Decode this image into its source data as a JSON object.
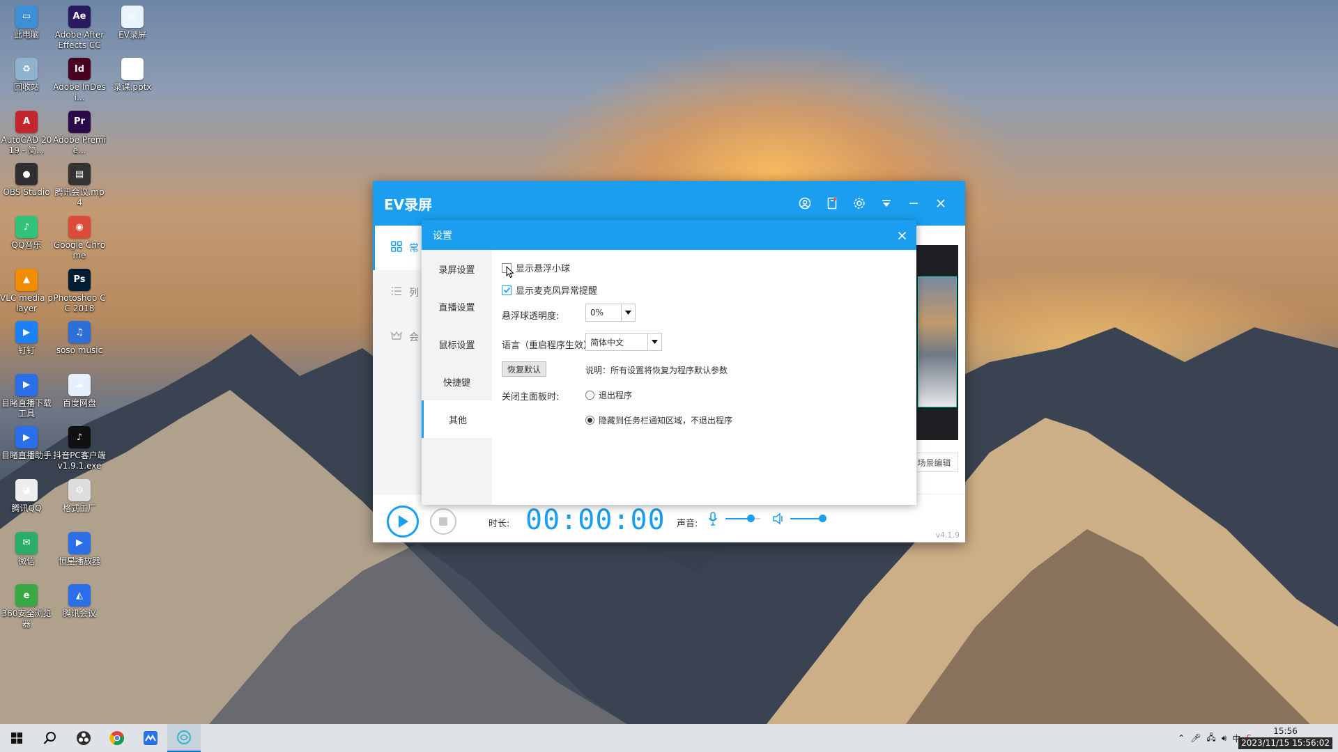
{
  "desktop_icons": [
    {
      "label": "此电脑",
      "color": "#3d8fd6",
      "glyph": "▭"
    },
    {
      "label": "Adobe After Effects CC ...",
      "color": "#2a1a5e",
      "glyph": "Ae"
    },
    {
      "label": "EV录屏",
      "color": "#e9f3fb",
      "glyph": "◎"
    },
    {
      "label": "回收站",
      "color": "#8fb2cf",
      "glyph": "♻"
    },
    {
      "label": "Adobe InDesi...",
      "color": "#49021f",
      "glyph": "Id"
    },
    {
      "label": "录课.pptx",
      "color": "#ffffff",
      "glyph": ""
    },
    {
      "label": "AutoCAD 2019 - 简...",
      "color": "#c4262e",
      "glyph": "A"
    },
    {
      "label": "Adobe Premie...",
      "color": "#2a0a4a",
      "glyph": "Pr"
    },
    {
      "label": "OBS Studio",
      "color": "#302e31",
      "glyph": "●"
    },
    {
      "label": "腾讯会议.mp4",
      "color": "#333333",
      "glyph": "▤"
    },
    {
      "label": "QQ音乐",
      "color": "#31c27c",
      "glyph": "♪"
    },
    {
      "label": "Google Chrome",
      "color": "#dd4b39",
      "glyph": "◉"
    },
    {
      "label": "VLC media player",
      "color": "#f18b00",
      "glyph": "▲"
    },
    {
      "label": "Photoshop CC 2018",
      "color": "#001d34",
      "glyph": "Ps"
    },
    {
      "label": "钉钉",
      "color": "#1b82f5",
      "glyph": "▶"
    },
    {
      "label": "soso music",
      "color": "#2d6fd8",
      "glyph": "♫"
    },
    {
      "label": "目睹直播下载工具",
      "color": "#2b6fe8",
      "glyph": "▶"
    },
    {
      "label": "百度网盘",
      "color": "#e6f0fc",
      "glyph": "☁"
    },
    {
      "label": "目睹直播助手",
      "color": "#2b6fe8",
      "glyph": "▶"
    },
    {
      "label": "抖音PC客户端 v1.9.1.exe",
      "color": "#111111",
      "glyph": "♪"
    },
    {
      "label": "腾讯QQ",
      "color": "#eeeeee",
      "glyph": "◕"
    },
    {
      "label": "格式工厂",
      "color": "#dddddd",
      "glyph": "⚙"
    },
    {
      "label": "微信",
      "color": "#2aae67",
      "glyph": "✉"
    },
    {
      "label": "恒星播放器",
      "color": "#2b6fe8",
      "glyph": "▶"
    },
    {
      "label": "360安全浏览器",
      "color": "#39a845",
      "glyph": "e"
    },
    {
      "label": "腾讯会议",
      "color": "#2b6fe8",
      "glyph": "◭"
    }
  ],
  "ev_window": {
    "title": "EV录屏",
    "sidebar": [
      {
        "label": "常",
        "icon": "grid-icon"
      },
      {
        "label": "列",
        "icon": "list-icon"
      },
      {
        "label": "会",
        "icon": "crown-icon"
      }
    ],
    "scene_edit": "场景编辑",
    "duration_label": "时长:",
    "timer": "00:00:00",
    "volume_label": "声音:",
    "mic_level": 0.72,
    "speaker_level": 0.88,
    "version": "v4.1.9"
  },
  "settings": {
    "title": "设置",
    "tabs": [
      "录屏设置",
      "直播设置",
      "鼠标设置",
      "快捷键",
      "其他"
    ],
    "active_tab": "其他",
    "show_float_ball": "显示悬浮小球",
    "show_mic_alert": "显示麦克风异常提醒",
    "opacity_label": "悬浮球透明度:",
    "opacity_value": "0%",
    "language_label": "语言（重启程序生效）:",
    "language_value": "简体中文",
    "reset_button": "恢复默认",
    "reset_note": "说明：所有设置将恢复为程序默认参数",
    "close_panel_label": "关闭主面板时:",
    "option_exit": "退出程序",
    "option_hide": "隐藏到任务栏通知区域，不退出程序"
  },
  "taskbar": {
    "clock_time": "15:56",
    "clock_datetime": "2023/11/15 15:56:02",
    "ime": "中"
  }
}
